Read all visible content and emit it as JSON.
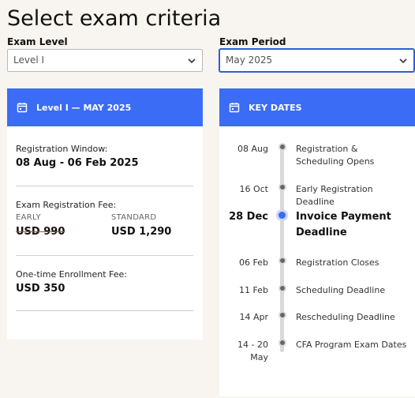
{
  "page": {
    "title": "Select exam criteria"
  },
  "filters": {
    "level": {
      "label": "Exam Level",
      "value": "Level I"
    },
    "period": {
      "label": "Exam Period",
      "value": "May 2025"
    }
  },
  "summary": {
    "header": "Level I — MAY 2025",
    "registration_window": {
      "label": "Registration Window:",
      "value": "08 Aug - 06 Feb 2025"
    },
    "exam_fee": {
      "label": "Exam Registration Fee:",
      "early": {
        "label": "EARLY",
        "value": "USD 990"
      },
      "standard": {
        "label": "STANDARD",
        "value": "USD 1,290"
      }
    },
    "enrollment_fee": {
      "label": "One-time Enrollment Fee:",
      "value": "USD 350"
    }
  },
  "key_dates": {
    "header": "KEY DATES",
    "items": [
      {
        "date": "08 Aug",
        "event": "Registration & Scheduling Opens"
      },
      {
        "date": "16 Oct",
        "event": "Early Registration Deadline"
      },
      {
        "date": "28 Dec",
        "event": "Invoice Payment Deadline"
      },
      {
        "date": "06 Feb",
        "event": "Registration Closes"
      },
      {
        "date": "11 Feb",
        "event": "Scheduling Deadline"
      },
      {
        "date": "14 Apr",
        "event": "Rescheduling Deadline"
      },
      {
        "date": "14 - 20 May",
        "event": "CFA Program Exam Dates"
      }
    ]
  },
  "colors": {
    "accent": "#3b6cf5",
    "background": "#f8f5f0"
  },
  "icons": {
    "calendar": "calendar-icon",
    "chevron": "chevron-down-icon"
  }
}
